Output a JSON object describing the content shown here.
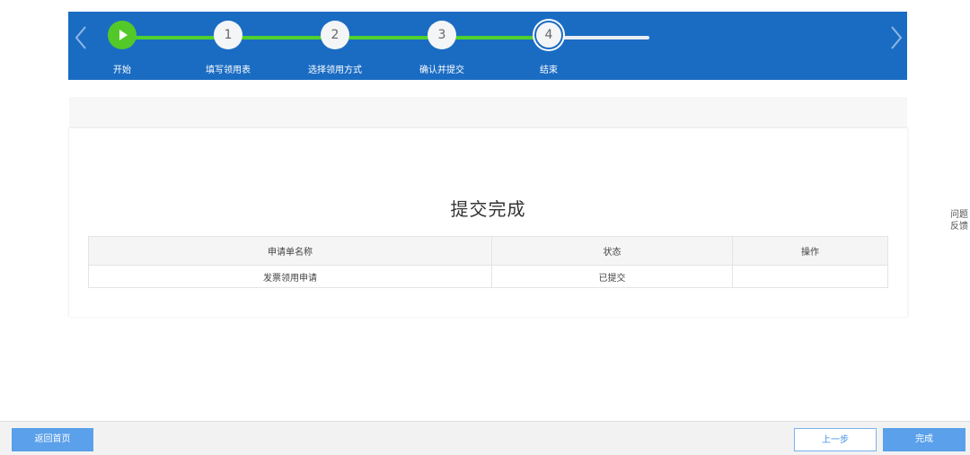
{
  "stepper": {
    "steps": [
      {
        "number": "",
        "label": "开始",
        "state": "done"
      },
      {
        "number": "1",
        "label": "填写领用表",
        "state": "done"
      },
      {
        "number": "2",
        "label": "选择领用方式",
        "state": "done"
      },
      {
        "number": "3",
        "label": "确认并提交",
        "state": "done"
      },
      {
        "number": "4",
        "label": "结束",
        "state": "current"
      }
    ]
  },
  "colors": {
    "bar": "#1a6cc3",
    "progress_done": "#4fd12b",
    "button": "#5aa0ea"
  },
  "main": {
    "title": "提交完成",
    "table": {
      "headers": [
        "申请单名称",
        "状态",
        "操作"
      ],
      "rows": [
        {
          "name": "发票领用申请",
          "status": "已提交",
          "action": ""
        }
      ]
    }
  },
  "sidebar": {
    "feedback_line1": "问题",
    "feedback_line2": "反馈"
  },
  "footer": {
    "home_label": "返回首页",
    "prev_label": "上一步",
    "done_label": "完成"
  }
}
